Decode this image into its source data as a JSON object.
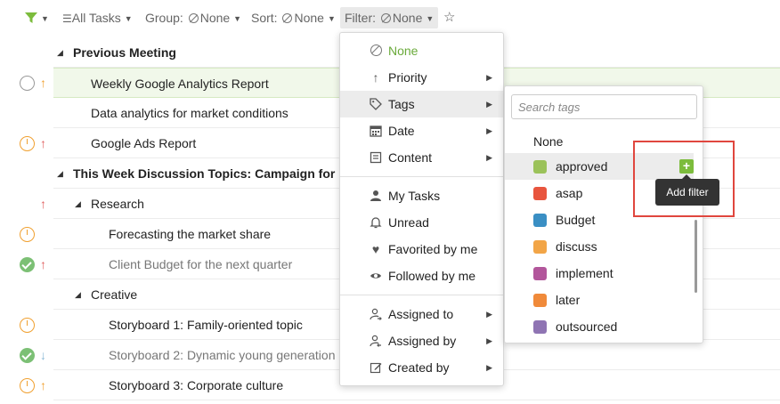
{
  "toolbar": {
    "all_tasks": "All Tasks",
    "group_label": "Group:",
    "group_value": "None",
    "sort_label": "Sort:",
    "sort_value": "None",
    "filter_label": "Filter:",
    "filter_value": "None"
  },
  "tasks": [
    {
      "text": "Previous Meeting",
      "kind": "section"
    },
    {
      "text": "Weekly Google Analytics Report",
      "status": "empty",
      "priority": "up-orange",
      "selected": true
    },
    {
      "text": "Data analytics for market conditions"
    },
    {
      "text": "Google Ads Report",
      "status": "in-progress",
      "priority": "up-red"
    },
    {
      "text": "This Week Discussion Topics: Campaign for BEV",
      "kind": "section"
    },
    {
      "text": "Research",
      "kind": "subsection",
      "priority": "up-red"
    },
    {
      "text": "Forecasting the market share",
      "status": "in-progress"
    },
    {
      "text": "Client Budget for the next quarter",
      "status": "done",
      "priority": "up-red"
    },
    {
      "text": "Creative",
      "kind": "subsection"
    },
    {
      "text": "Storyboard 1: Family-oriented topic",
      "status": "in-progress"
    },
    {
      "text": "Storyboard 2: Dynamic young generation",
      "status": "done",
      "priority": "down-blue"
    },
    {
      "text": "Storyboard 3: Corporate culture",
      "status": "in-progress",
      "priority": "up-orange"
    }
  ],
  "filter_menu": {
    "none": "None",
    "priority": "Priority",
    "tags": "Tags",
    "date": "Date",
    "content": "Content",
    "my_tasks": "My Tasks",
    "unread": "Unread",
    "favorited": "Favorited by me",
    "followed": "Followed by me",
    "assigned_to": "Assigned to",
    "assigned_by": "Assigned by",
    "created_by": "Created by"
  },
  "tags_menu": {
    "search_placeholder": "Search tags",
    "none": "None",
    "items": [
      {
        "label": "approved",
        "color": "#9bc25a"
      },
      {
        "label": "asap",
        "color": "#e8553e"
      },
      {
        "label": "Budget",
        "color": "#3a8fc4"
      },
      {
        "label": "discuss",
        "color": "#f2a547"
      },
      {
        "label": "implement",
        "color": "#b2569b"
      },
      {
        "label": "later",
        "color": "#f08a3a"
      },
      {
        "label": "outsourced",
        "color": "#8f74b3"
      }
    ],
    "add_tooltip": "Add filter"
  }
}
